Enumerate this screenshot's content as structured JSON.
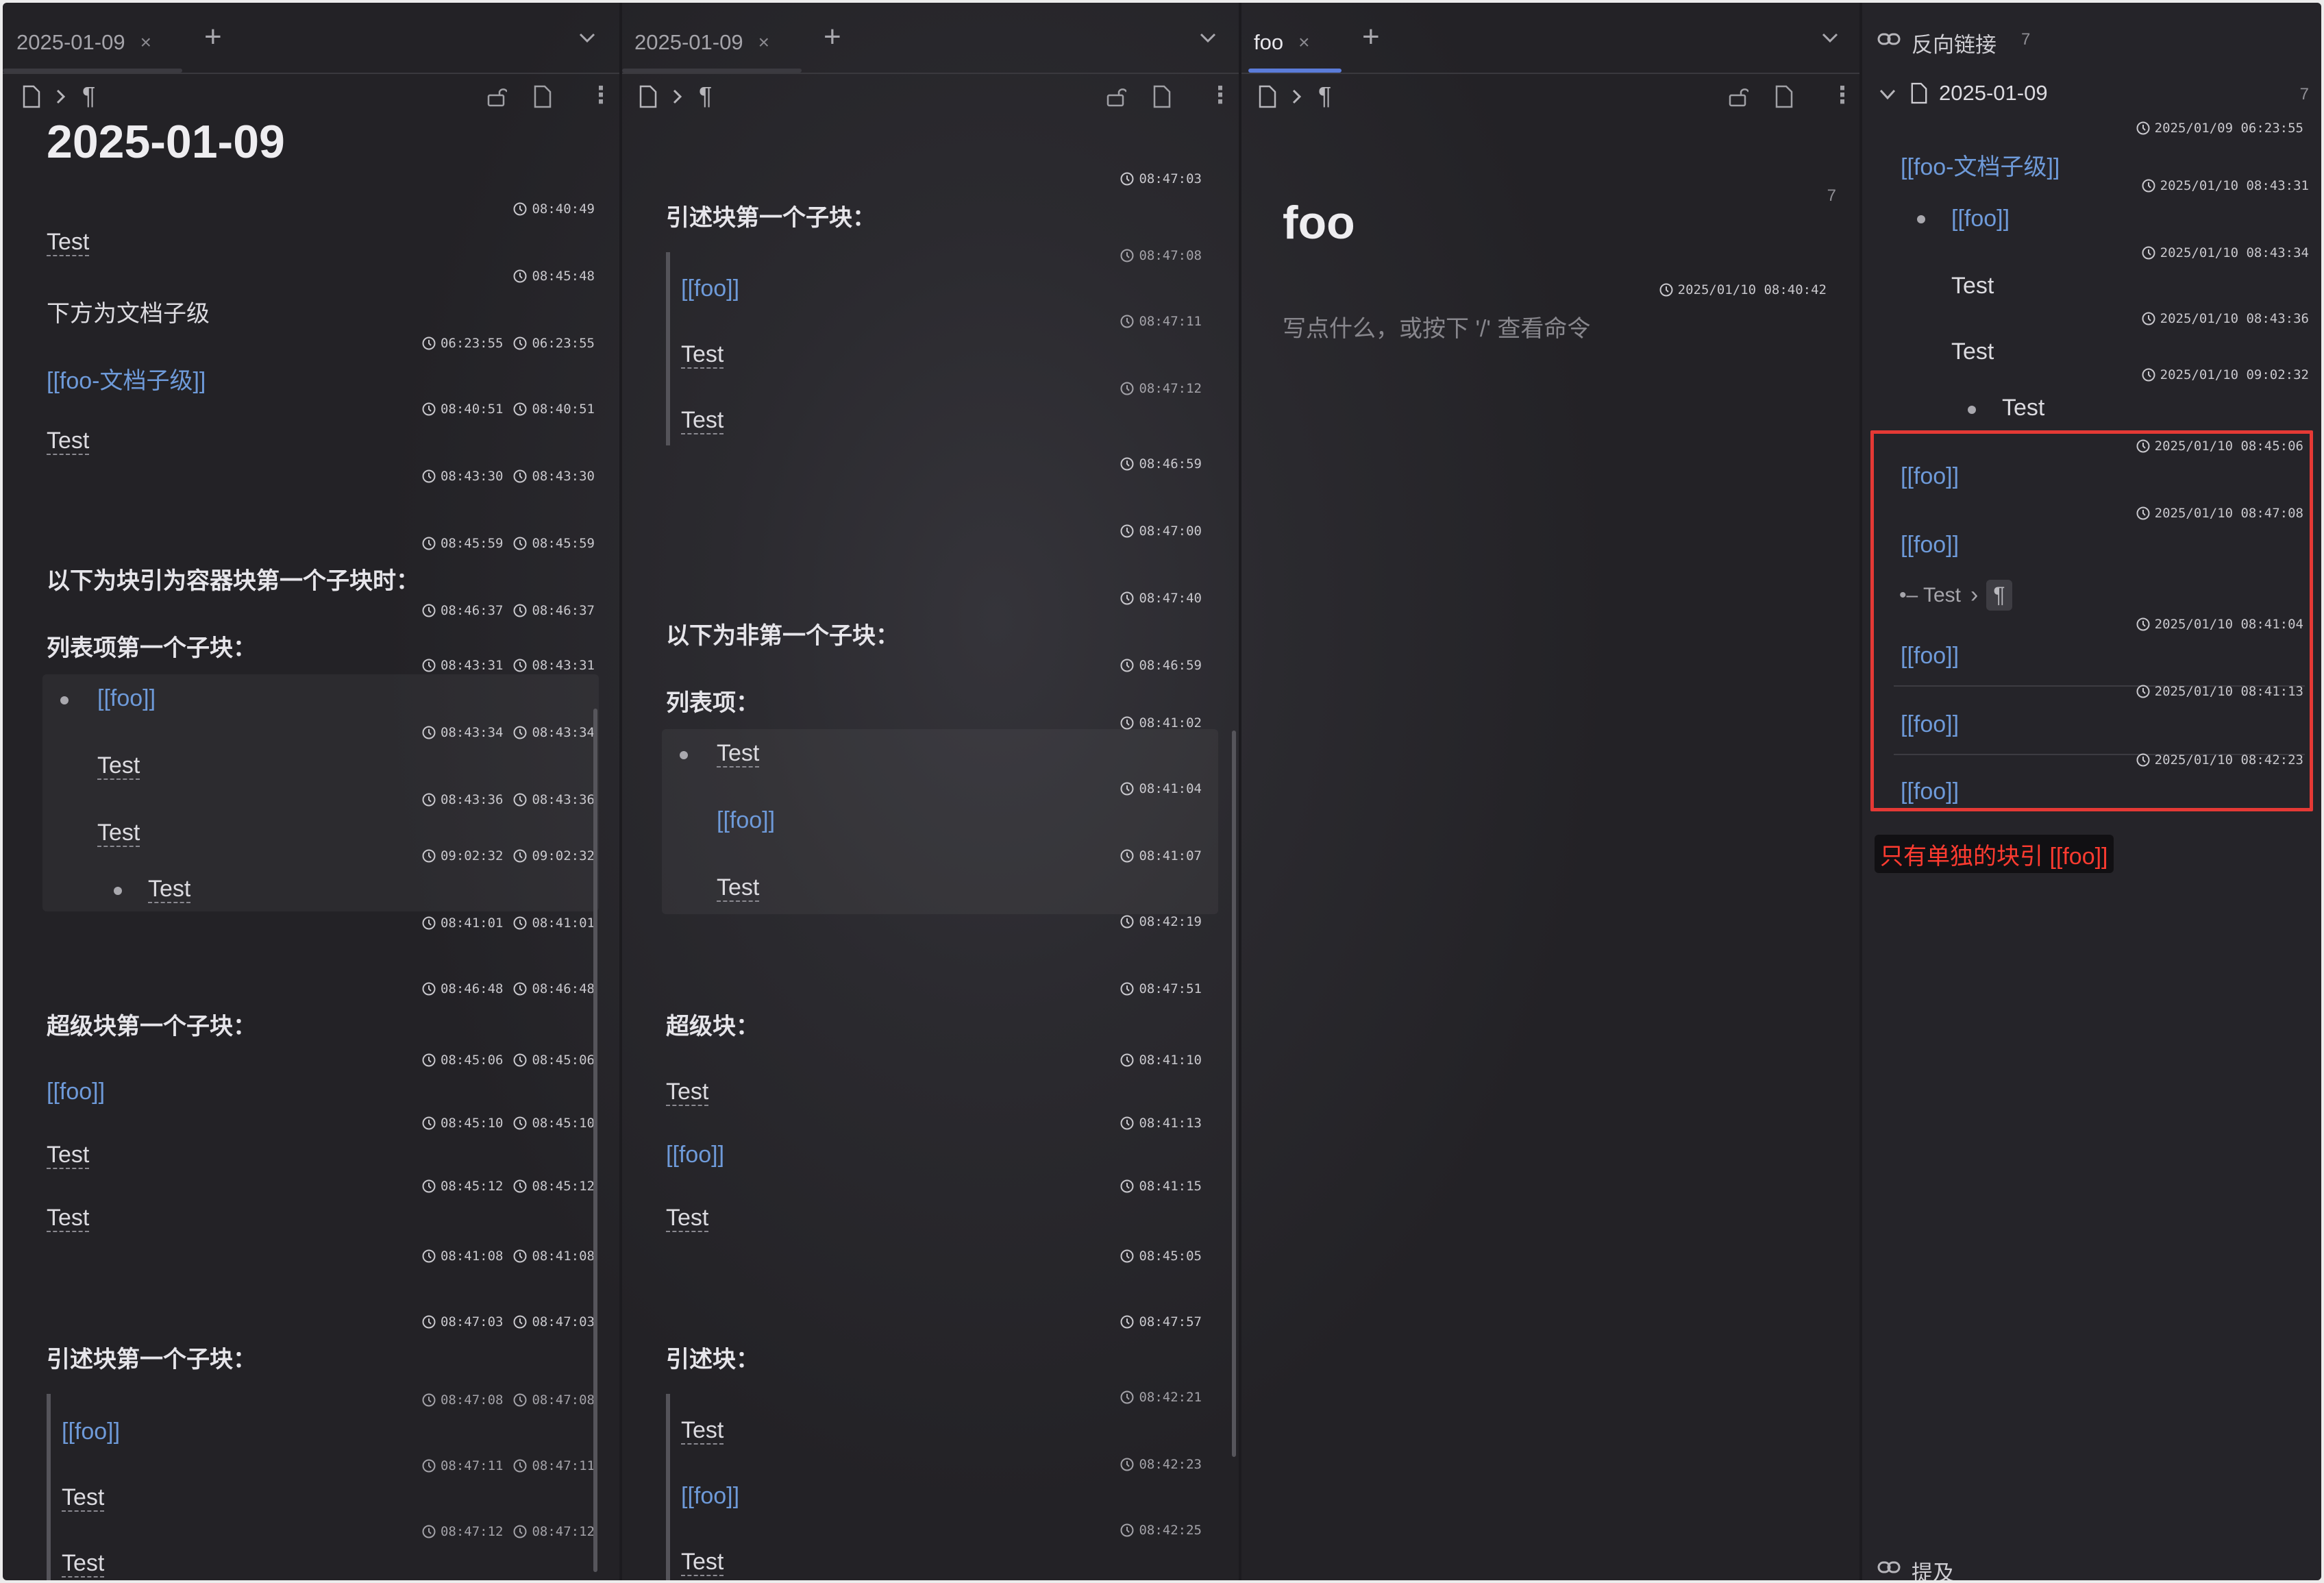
{
  "panel1": {
    "tab": {
      "label": "2025-01-09",
      "close": "×"
    },
    "title": "2025-01-09",
    "blocks": {
      "b1": {
        "text": "Test",
        "ts": [
          "08:40:49"
        ]
      },
      "b2": {
        "text": "下方为文档子级",
        "ts": [
          "08:45:48"
        ]
      },
      "b3": {
        "text": "[[foo-文档子级]]",
        "ts": [
          "06:23:55",
          "06:23:55"
        ]
      },
      "b4": {
        "text": "Test",
        "ts": [
          "08:40:51",
          "08:40:51"
        ]
      },
      "b5": {
        "ts": [
          "08:43:30",
          "08:43:30"
        ]
      },
      "b6": {
        "text": "以下为块引为容器块第一个子块时：",
        "ts": [
          "08:45:59",
          "08:45:59"
        ]
      },
      "b7": {
        "text": "列表项第一个子块：",
        "ts": [
          "08:46:37",
          "08:46:37"
        ]
      },
      "b8": {
        "text": "[[foo]]",
        "ts": [
          "08:43:31",
          "08:43:31"
        ]
      },
      "b9": {
        "text": "Test",
        "ts": [
          "08:43:34",
          "08:43:34"
        ]
      },
      "b10": {
        "text": "Test",
        "ts": [
          "08:43:36",
          "08:43:36"
        ]
      },
      "b11": {
        "text": "Test",
        "ts": [
          "09:02:32",
          "09:02:32"
        ]
      },
      "b12": {
        "ts": [
          "08:41:01",
          "08:41:01"
        ]
      },
      "b13": {
        "text": "超级块第一个子块：",
        "ts": [
          "08:46:48",
          "08:46:48"
        ]
      },
      "b14": {
        "text": "[[foo]]",
        "ts": [
          "08:45:06",
          "08:45:06"
        ]
      },
      "b15": {
        "text": "Test",
        "ts": [
          "08:45:10",
          "08:45:10"
        ]
      },
      "b16": {
        "text": "Test",
        "ts": [
          "08:45:12",
          "08:45:12"
        ]
      },
      "b17": {
        "ts": [
          "08:41:08",
          "08:41:08"
        ]
      },
      "b18": {
        "text": "引述块第一个子块：",
        "ts": [
          "08:47:03",
          "08:47:03"
        ]
      },
      "b19": {
        "text": "[[foo]]",
        "ts": [
          "08:47:08",
          "08:47:08"
        ]
      },
      "b20": {
        "text": "Test",
        "ts": [
          "08:47:11",
          "08:47:11"
        ]
      },
      "b21": {
        "text": "Test",
        "ts": [
          "08:47:12",
          "08:47:12"
        ]
      }
    }
  },
  "panel2": {
    "tab": {
      "label": "2025-01-09",
      "close": "×"
    },
    "blocks": {
      "ts0": "08:47:03",
      "h1": "引述块第一个子块：",
      "q1": {
        "text": "[[foo]]",
        "ts": "08:47:08"
      },
      "q2": {
        "text": "Test",
        "ts": "08:47:11"
      },
      "q3": {
        "text": "Test",
        "ts": "08:47:12"
      },
      "e1": "08:46:59",
      "e2": "08:47:00",
      "h2": {
        "text": "以下为非第一个子块：",
        "ts": "08:47:40"
      },
      "h3": {
        "text": "列表项：",
        "ts": "08:46:59"
      },
      "l1": {
        "text": "Test",
        "ts": "08:41:02"
      },
      "l2": {
        "text": "[[foo]]",
        "ts": "08:41:04"
      },
      "l3": {
        "text": "Test",
        "ts": "08:41:07"
      },
      "e3": "08:42:19",
      "h4": {
        "text": "超级块：",
        "ts": "08:47:51"
      },
      "s1": {
        "text": "Test",
        "ts": "08:41:10"
      },
      "s2": {
        "text": "[[foo]]",
        "ts": "08:41:13"
      },
      "s3": {
        "text": "Test",
        "ts": "08:41:15"
      },
      "e4": "08:45:05",
      "h5": {
        "text": "引述块：",
        "ts": "08:47:57"
      },
      "r1": {
        "text": "Test",
        "ts": "08:42:21"
      },
      "r2": {
        "text": "[[foo]]",
        "ts": "08:42:23"
      },
      "r3": {
        "text": "Test",
        "ts": "08:42:25"
      }
    }
  },
  "panel3": {
    "tab": {
      "label": "foo",
      "close": "×"
    },
    "title": "foo",
    "count": "7",
    "ts": "2025/01/10 08:40:42",
    "placeholder": "写点什么，或按下 '/' 查看命令"
  },
  "backlinks": {
    "header": "反向链接",
    "count": "7",
    "doc": {
      "label": "2025-01-09",
      "count": "7"
    },
    "items": {
      "i1": {
        "text": "[[foo-文档子级]]",
        "ts": "2025/01/09 06:23:55"
      },
      "i2": {
        "text": "[[foo]]",
        "ts": "2025/01/10 08:43:31"
      },
      "i3": {
        "text": "Test",
        "ts": "2025/01/10 08:43:34"
      },
      "i4": {
        "text": "Test",
        "ts": "2025/01/10 08:43:36"
      },
      "i5": {
        "text": "Test",
        "ts": "2025/01/10 09:02:32"
      },
      "i6": {
        "text": "[[foo]]",
        "ts": "2025/01/10 08:45:06"
      },
      "i7": {
        "text": "[[foo]]",
        "ts": "2025/01/10 08:47:08"
      },
      "i8": {
        "text": "[[foo]]",
        "ts": "2025/01/10 08:41:04"
      },
      "i9": {
        "text": "[[foo]]",
        "ts": "2025/01/10 08:41:13"
      },
      "i10": {
        "text": "[[foo]]",
        "ts": "2025/01/10 08:42:23"
      }
    },
    "breadcrumb": {
      "prefix": "•– Test",
      "sep": "›",
      "pilcrow": "¶"
    },
    "annotation": "只有单独的块引 [[foo]]",
    "mentions": "提及"
  },
  "colors": {
    "link": "#6e9ad9",
    "accent": "#5b7cd9",
    "annotation": "#ff3b30",
    "highlight_box": "#e53935"
  }
}
